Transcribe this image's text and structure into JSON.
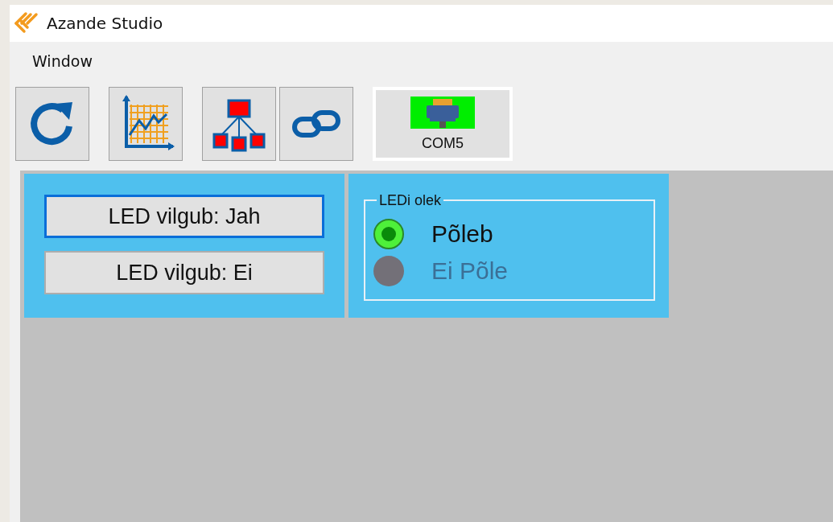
{
  "window": {
    "title": "Azande Studio"
  },
  "menu": [
    {
      "label": "Window"
    }
  ],
  "toolbar": [
    {
      "kind": "refresh"
    },
    {
      "kind": "chart"
    },
    {
      "kind": "hierarchy"
    },
    {
      "kind": "link"
    }
  ],
  "port": {
    "label": "COM5",
    "connected": true
  },
  "led_buttons": [
    {
      "label": "LED vilgub: Jah",
      "focused": true
    },
    {
      "label": "LED vilgub: Ei",
      "focused": false
    }
  ],
  "led_group": {
    "title": "LEDi olek",
    "indicators": [
      {
        "label": "Põleb",
        "on": true
      },
      {
        "label": "Ei Põle",
        "on": false
      }
    ]
  }
}
